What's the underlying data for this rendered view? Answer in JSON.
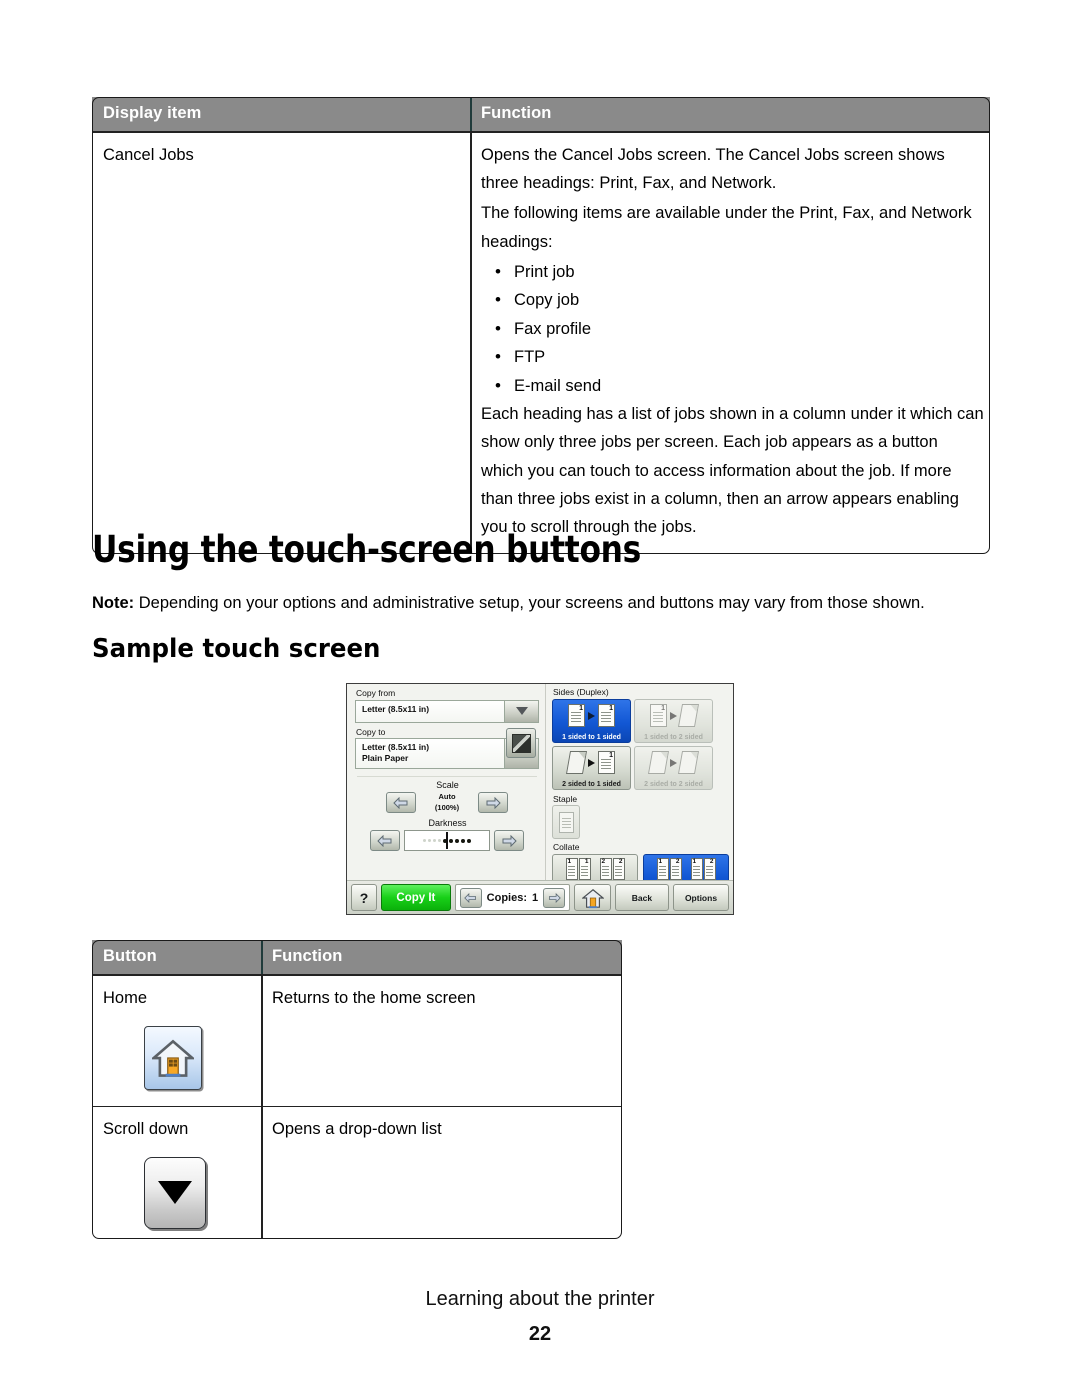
{
  "table_cancel_jobs": {
    "headers": [
      "Display item",
      "Function"
    ],
    "row": {
      "display_item": "Cancel Jobs",
      "para1": "Opens the Cancel Jobs screen. The Cancel Jobs screen shows three headings: Print, Fax, and Network.",
      "para2": "The following items are available under the Print, Fax, and Network headings:",
      "bullets": [
        "Print job",
        "Copy job",
        "Fax profile",
        "FTP",
        "E-mail send"
      ],
      "para3": "Each heading has a list of jobs shown in a column under it which can show only three jobs per screen. Each job appears as a button which you can touch to access information about the job. If more than three jobs exist in a column, then an arrow appears enabling you to scroll through the jobs."
    }
  },
  "headings": {
    "h1": "Using the touch-screen buttons",
    "note_label": "Note:",
    "note_text": " Depending on your options and administrative setup, your screens and buttons may vary from those shown.",
    "h2": "Sample touch screen"
  },
  "touchscreen": {
    "copy_from": {
      "label": "Copy from",
      "value": "Letter (8.5x11 in)"
    },
    "copy_to": {
      "label": "Copy to",
      "value_line1": "Letter (8.5x11 in)",
      "value_line2": "Plain Paper"
    },
    "scale": {
      "label": "Scale",
      "value_line1": "Auto",
      "value_line2": "(100%)"
    },
    "darkness": {
      "label": "Darkness"
    },
    "sides": {
      "label": "Sides (Duplex)",
      "tiles": [
        {
          "caption": "1 sided to 1 sided",
          "state": "selected"
        },
        {
          "caption": "1 sided to 2 sided",
          "state": "disabled"
        },
        {
          "caption": "2 sided to 1 sided",
          "state": "normal"
        },
        {
          "caption": "2 sided to 2 sided",
          "state": "disabled"
        }
      ]
    },
    "staple": {
      "label": "Staple"
    },
    "collate": {
      "label": "Collate",
      "tiles": [
        {
          "caption": "Off [1,1,1,2,2,2]",
          "state": "normal"
        },
        {
          "caption": "On [1,2,1,2,1,2]",
          "state": "selected"
        }
      ]
    },
    "bottom_bar": {
      "help": "?",
      "copy_it": "Copy It",
      "copies_label": "Copies:",
      "copies_value": "1",
      "back": "Back",
      "options": "Options"
    },
    "colors": {
      "selected_blue": "#1257d4",
      "copy_it_green": "#18d018",
      "screen_background": "#f2f3ef"
    }
  },
  "table_buttons": {
    "headers": [
      "Button",
      "Function"
    ],
    "rows": [
      {
        "name": "Home",
        "function": "Returns to the home screen",
        "icon": "home-icon"
      },
      {
        "name": "Scroll down",
        "function": "Opens a drop-down list",
        "icon": "scroll-down-icon"
      }
    ]
  },
  "footer": {
    "title": "Learning about the printer",
    "page_number": "22"
  }
}
